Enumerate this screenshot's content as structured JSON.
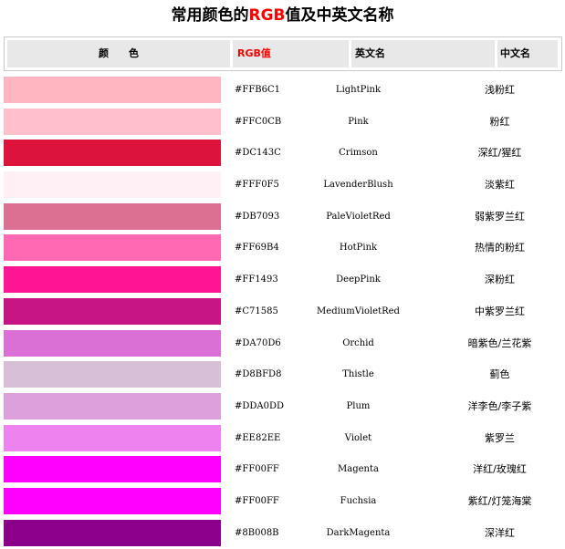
{
  "title": {
    "prefix": "常用颜色的",
    "rgb": "RGB",
    "suffix": "值及中英文名称"
  },
  "header": {
    "color": "颜　　色",
    "rgb": "RGB值",
    "english": "英文名",
    "chinese": "中文名"
  },
  "rows": [
    {
      "color": "#FFB6C1",
      "hex": "#FFB6C1",
      "en": "LightPink",
      "cn": "浅粉红"
    },
    {
      "color": "#FFC0CB",
      "hex": "#FFC0CB",
      "en": "Pink",
      "cn": "粉红"
    },
    {
      "color": "#DC143C",
      "hex": "#DC143C",
      "en": "Crimson",
      "cn": "深红/猩红"
    },
    {
      "color": "#FFF0F5",
      "hex": "#FFF0F5",
      "en": "LavenderBlush",
      "cn": "淡紫红"
    },
    {
      "color": "#DB7093",
      "hex": "#DB7093",
      "en": "PaleVioletRed",
      "cn": "弱紫罗兰红"
    },
    {
      "color": "#FF69B4",
      "hex": "#FF69B4",
      "en": "HotPink",
      "cn": "热情的粉红"
    },
    {
      "color": "#FF1493",
      "hex": "#FF1493",
      "en": "DeepPink",
      "cn": "深粉红"
    },
    {
      "color": "#C71585",
      "hex": "#C71585",
      "en": "MediumVioletRed",
      "cn": "中紫罗兰红"
    },
    {
      "color": "#DA70D6",
      "hex": "#DA70D6",
      "en": "Orchid",
      "cn": "暗紫色/兰花紫"
    },
    {
      "color": "#D8BFD8",
      "hex": "#D8BFD8",
      "en": "Thistle",
      "cn": "蓟色"
    },
    {
      "color": "#DDA0DD",
      "hex": "#DDA0DD",
      "en": "Plum",
      "cn": "洋李色/李子紫"
    },
    {
      "color": "#EE82EE",
      "hex": "#EE82EE",
      "en": "Violet",
      "cn": "紫罗兰"
    },
    {
      "color": "#FF00FF",
      "hex": "#FF00FF",
      "en": "Magenta",
      "cn": "洋红/玫瑰红"
    },
    {
      "color": "#FF00FF",
      "hex": "#FF00FF",
      "en": "Fuchsia",
      "cn": "紫红/灯笼海棠"
    },
    {
      "color": "#8B008B",
      "hex": "#8B008B",
      "en": "DarkMagenta",
      "cn": "深洋红"
    }
  ]
}
